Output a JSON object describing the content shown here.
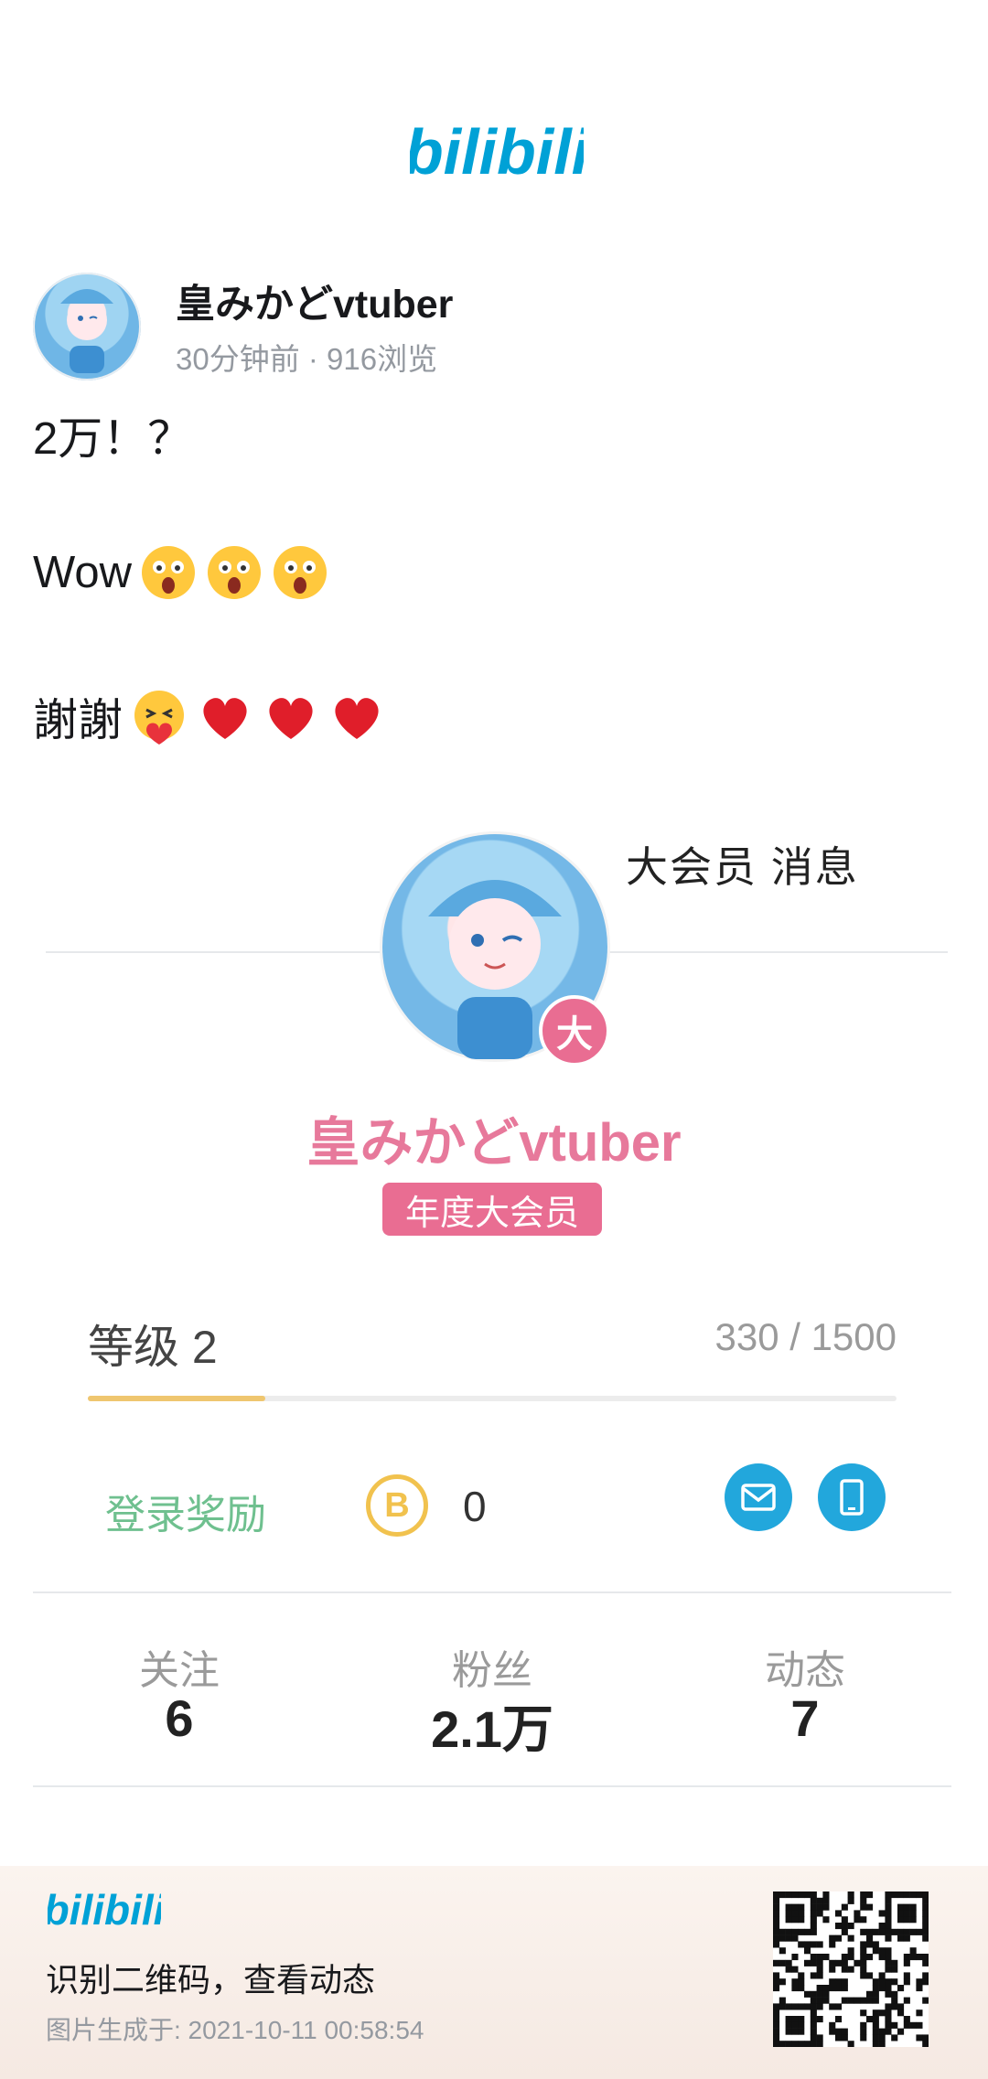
{
  "logo": {
    "text": "bilibili",
    "color": "#00a1d6"
  },
  "author": {
    "name": "皇みかどvtuber",
    "meta": "30分钟前 · 916浏览"
  },
  "post": {
    "line1": "2万！？",
    "line2": "Wow",
    "line2_emojis": [
      "astonished-emoji",
      "astonished-emoji",
      "astonished-emoji"
    ],
    "line3": "謝謝",
    "line3_emojis": [
      "hugging-emoji",
      "heart-emoji",
      "heart-emoji",
      "heart-emoji"
    ]
  },
  "screenshot": {
    "nav": "大会员 消息 ",
    "avatar_badge": "大",
    "name": "皇みかどvtuber",
    "vip_tag": "年度大会员",
    "level_label": "等级 2",
    "level_value": "330 / 1500",
    "level_progress": 0.22,
    "login_reward": "登录奖励",
    "coin_symbol": "B",
    "coin_count": "0",
    "stats": [
      {
        "label": "关注",
        "value": "6"
      },
      {
        "label": "粉丝",
        "value": "2.1万"
      },
      {
        "label": "动态",
        "value": "7"
      }
    ]
  },
  "footer": {
    "logo": "bilibili",
    "cta": "识别二维码，查看动态",
    "generated": "图片生成于: 2021-10-11 00:58:54"
  },
  "colors": {
    "brand_blue": "#00a1d6",
    "vip_pink": "#e96d92",
    "level_gold": "#efc66f",
    "reward_green": "#6fc08f"
  }
}
